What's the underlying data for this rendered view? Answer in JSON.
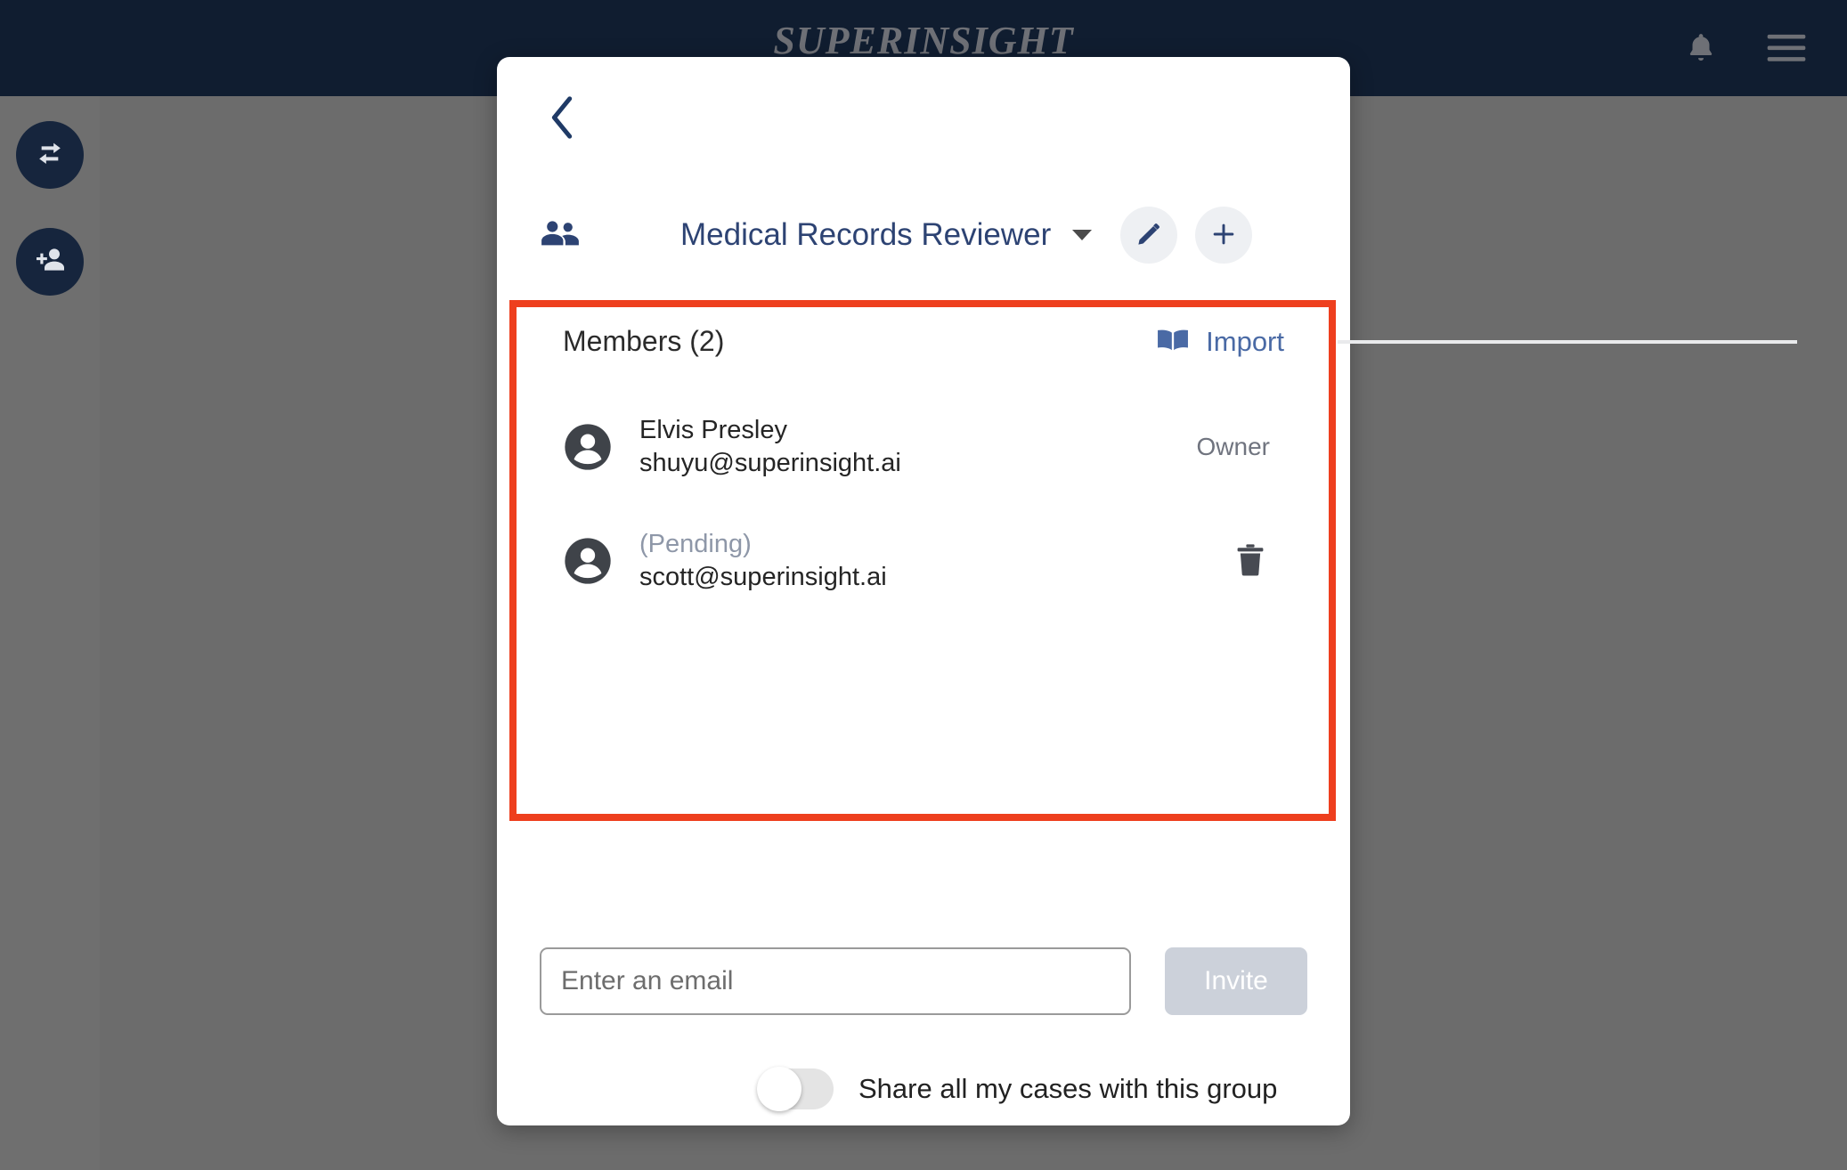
{
  "topbar": {
    "brand": "SUPERINSIGHT",
    "notifications_icon": "bell-icon",
    "menu_icon": "hamburger-menu-icon",
    "background_color": "#101d30",
    "brand_color": "#6e7076"
  },
  "rail": {
    "items": [
      {
        "icon": "swap-arrows-icon",
        "label": ""
      },
      {
        "icon": "add-person-icon",
        "label": ""
      }
    ],
    "button_color": "#16253d"
  },
  "dialog": {
    "back_icon": "chevron-left-icon",
    "group_icon": "people-group-icon",
    "group_title": "Medical Records Reviewer",
    "group_dropdown_icon": "caret-down-icon",
    "edit_icon": "pencil-icon",
    "add_icon": "plus-icon",
    "title_color": "#2d4373"
  },
  "members": {
    "heading": "Members (2)",
    "import_label": "Import",
    "import_icon": "open-book-icon",
    "import_color": "#4a6aa5",
    "rows": [
      {
        "avatar_icon": "person-avatar-icon",
        "name": "Elvis Presley",
        "email": "shuyu@superinsight.ai",
        "role": "Owner",
        "pending": false,
        "action_icon": ""
      },
      {
        "avatar_icon": "person-avatar-icon",
        "name": "(Pending)",
        "email": "scott@superinsight.ai",
        "role": "",
        "pending": true,
        "action_icon": "trash-icon"
      }
    ]
  },
  "invite": {
    "placeholder": "Enter an email",
    "value": "",
    "button_label": "Invite",
    "button_disabled": true
  },
  "share": {
    "label": "Share all my cases with this group",
    "enabled": false
  },
  "annotation": {
    "highlight_color": "#ee3f1e",
    "shape": "rectangle"
  }
}
